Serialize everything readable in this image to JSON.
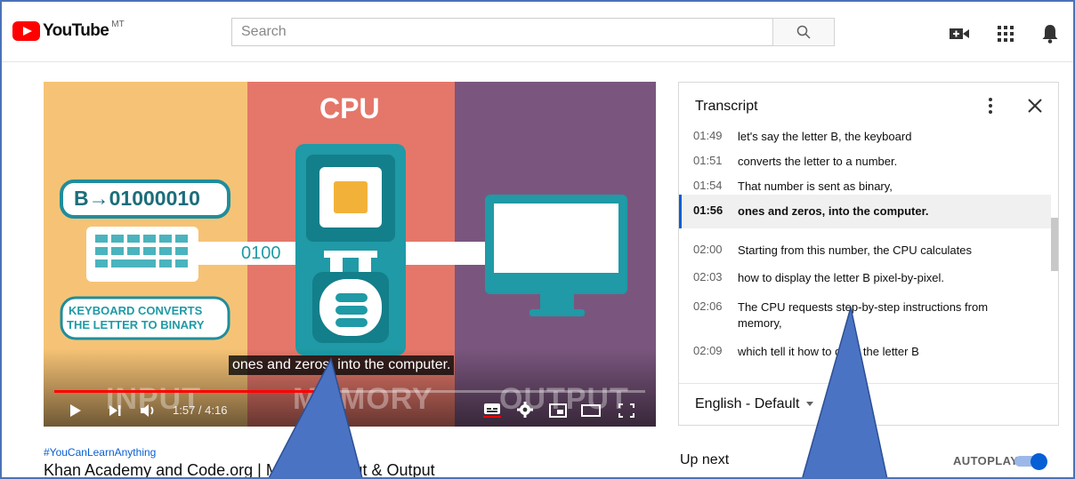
{
  "header": {
    "logo_text": "YouTube",
    "logo_badge": "MT",
    "search_placeholder": "Search",
    "icons": [
      "search-icon",
      "video-camera-icon",
      "apps-grid-icon",
      "notifications-bell-icon"
    ]
  },
  "video": {
    "slide": {
      "cpu_label": "CPU",
      "binary_label": "B→01000010",
      "keyboard_text_line1": "KEYBOARD CONVERTS",
      "keyboard_text_line2": "THE LETTER TO BINARY",
      "binary_stream": "0100",
      "bottom_input": "INPUT",
      "bottom_memory": "MEMORY",
      "bottom_output": "OUTPUT"
    },
    "caption": "ones and zeros, into the computer.",
    "time_display": "1:57 / 4:16",
    "progress_fraction": 0.468,
    "colors": {
      "progress": "#ff0000",
      "input_panel": "#f6c376",
      "cpu_panel": "#e4776a",
      "output_panel": "#7a567e"
    }
  },
  "meta": {
    "hashtag": "#YouCanLearnAnything",
    "title": "Khan Academy and Code.org | Memory, Input & Output"
  },
  "transcript": {
    "title": "Transcript",
    "rows": [
      {
        "time": "01:49",
        "text": "let's say the letter B, the keyboard"
      },
      {
        "time": "01:51",
        "text": "converts the letter to a number."
      },
      {
        "time": "01:54",
        "text": "That number is sent as binary,"
      },
      {
        "time": "01:56",
        "text": "ones and zeros, into the computer."
      },
      {
        "time": "02:00",
        "text": "Starting from this number, the CPU calculates"
      },
      {
        "time": "02:03",
        "text": "how to display the letter B pixel-by-pixel."
      },
      {
        "time": "02:06",
        "text": "The CPU requests step-by-step instructions from memory,"
      },
      {
        "time": "02:09",
        "text": "which tell it how to draw the letter B"
      }
    ],
    "active_index": 3,
    "language": "English - Default"
  },
  "sidebar": {
    "up_next": "Up next",
    "autoplay": "AUTOPLAY",
    "autoplay_on": true
  },
  "annotation_color": "#4a73c4"
}
